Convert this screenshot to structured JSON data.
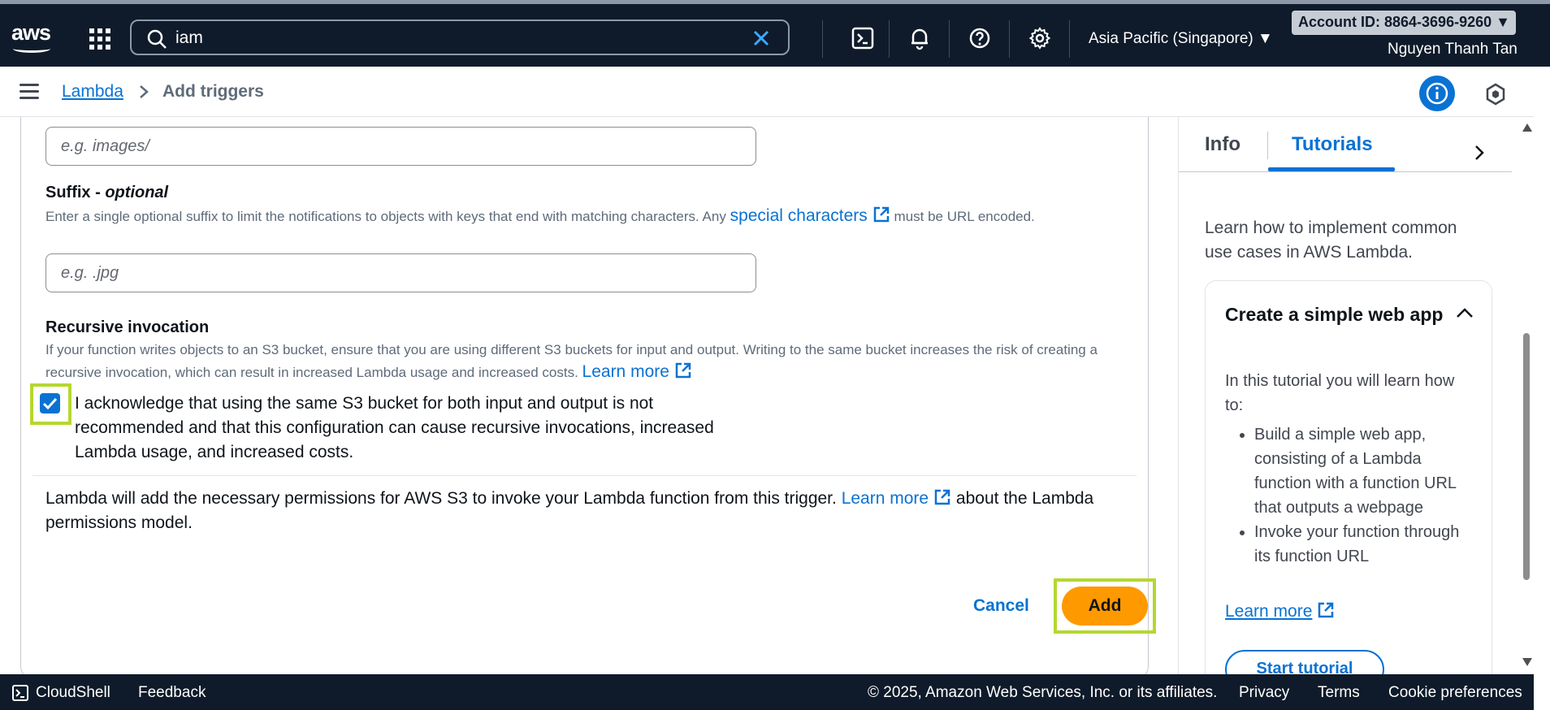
{
  "topnav": {
    "logo_text": "aws",
    "search_value": "iam",
    "region": "Asia Pacific (Singapore) ▼",
    "account": "Account ID: 8864-3696-9260 ▼",
    "user": "Nguyen Thanh Tan"
  },
  "breadcrumb": {
    "parent": "Lambda",
    "current": "Add triggers"
  },
  "form": {
    "prefix_placeholder": "e.g. images/",
    "suffix_label": "Suffix - ",
    "suffix_label_optional": "optional",
    "suffix_desc": "Enter a single optional suffix to limit the notifications to objects with keys that end with matching characters. Any ",
    "suffix_desc_link": "special characters",
    "suffix_desc_tail": " must be URL encoded.",
    "suffix_placeholder": "e.g. .jpg",
    "recursive_label": "Recursive invocation",
    "recursive_desc": "If your function writes objects to an S3 bucket, ensure that you are using different S3 buckets for input and output. Writing to the same bucket increases the risk of creating a recursive invocation, which can result in increased Lambda usage and increased costs. ",
    "learn_more": "Learn more",
    "acknowledge_text": "I acknowledge that using the same S3 bucket for both input and output is not recommended and that this configuration can cause recursive invocations, increased Lambda usage, and increased costs.",
    "acknowledge_checked": true,
    "permissions_text": "Lambda will add the necessary permissions for AWS S3 to invoke your Lambda function from this trigger. ",
    "permissions_link": "Learn more",
    "permissions_tail": " about the Lambda permissions model."
  },
  "actions": {
    "cancel": "Cancel",
    "add": "Add"
  },
  "panel": {
    "tab_info": "Info",
    "tab_tutorials": "Tutorials",
    "intro": "Learn how to implement common use cases in AWS Lambda.",
    "tutorial_title": "Create a simple web app",
    "tutorial_body": "In this tutorial you will learn how to:",
    "tutorial_items": [
      "Build a simple web app, consisting of a Lambda function with a function URL that outputs a webpage",
      "Invoke your function through its function URL"
    ],
    "tutorial_learn_more": "Learn more",
    "start_tutorial": "Start tutorial"
  },
  "footer": {
    "cloudshell": "CloudShell",
    "feedback": "Feedback",
    "copyright": "© 2025, Amazon Web Services, Inc. or its affiliates.",
    "privacy": "Privacy",
    "terms": "Terms",
    "cookies": "Cookie preferences"
  },
  "colors": {
    "nav_bg": "#0f1b2a",
    "link": "#0972d3",
    "primary_button": "#ff9900",
    "highlight": "#b5d730"
  }
}
